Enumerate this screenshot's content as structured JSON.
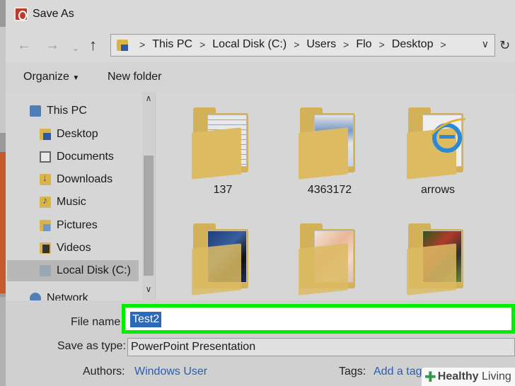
{
  "window": {
    "title": "Save As"
  },
  "address": {
    "crumbs": [
      "This PC",
      "Local Disk (C:)",
      "Users",
      "Flo",
      "Desktop"
    ]
  },
  "toolbar": {
    "organize": "Organize",
    "new_folder": "New folder"
  },
  "navpane": {
    "items": [
      {
        "label": "This PC",
        "icon": "computer-icon"
      },
      {
        "label": "Desktop",
        "icon": "desktop-folder-icon"
      },
      {
        "label": "Documents",
        "icon": "documents-folder-icon"
      },
      {
        "label": "Downloads",
        "icon": "downloads-folder-icon"
      },
      {
        "label": "Music",
        "icon": "music-folder-icon"
      },
      {
        "label": "Pictures",
        "icon": "pictures-folder-icon"
      },
      {
        "label": "Videos",
        "icon": "videos-folder-icon"
      },
      {
        "label": "Local Disk (C:)",
        "icon": "disk-icon",
        "selected": true
      },
      {
        "label": "Network",
        "icon": "network-icon"
      }
    ]
  },
  "files": [
    {
      "label": "137",
      "kind": "folder"
    },
    {
      "label": "4363172",
      "kind": "folder"
    },
    {
      "label": "arrows",
      "kind": "folder-ie"
    },
    {
      "label": "",
      "kind": "folder-photo"
    },
    {
      "label": "",
      "kind": "folder-photo"
    },
    {
      "label": "",
      "kind": "folder-photo"
    }
  ],
  "form": {
    "file_name_label": "File name",
    "file_name_value": "Test2",
    "save_type_label": "Save as type:",
    "save_type_value": "PowerPoint Presentation",
    "authors_label": "Authors:",
    "authors_value": "Windows User",
    "tags_label": "Tags:",
    "tags_value": "Add a tag"
  },
  "colors": {
    "highlight": "#00ee00",
    "selection": "#2c6ab8",
    "link": "#2a5db0",
    "folder": "#d2b158"
  },
  "watermark": {
    "bold": "Healthy",
    "light": "Living"
  }
}
